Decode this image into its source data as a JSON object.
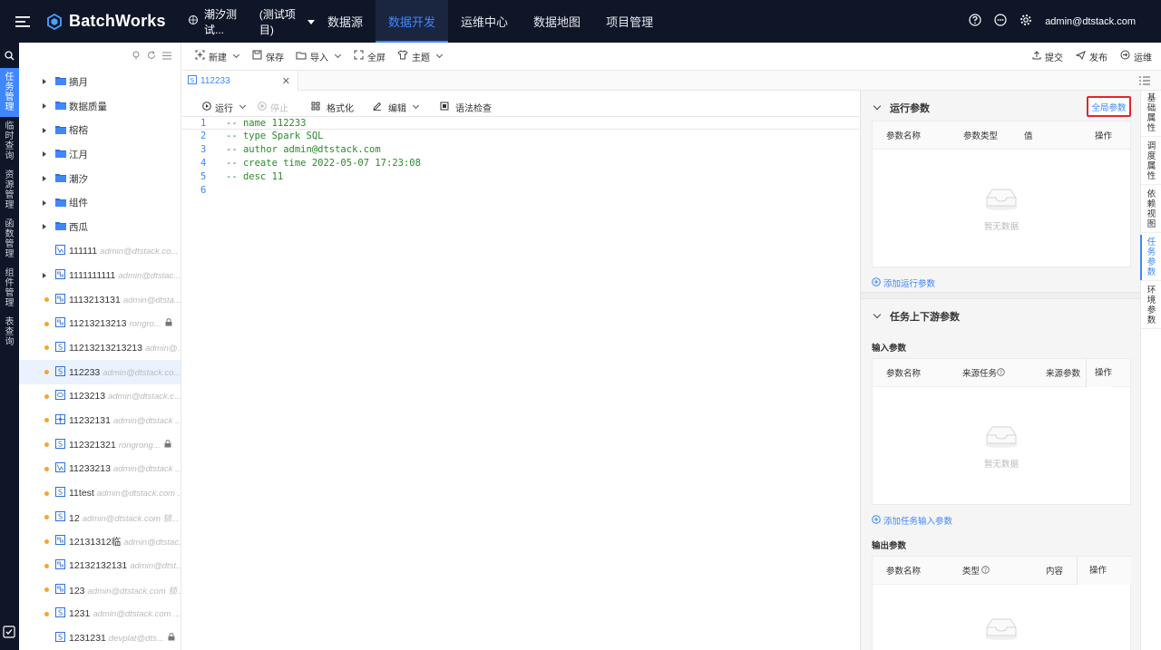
{
  "topbar": {
    "app_name": "BatchWorks",
    "project_name": "潮汐测试...",
    "project_tag": "(测试项目)",
    "nav": [
      "数据源",
      "数据开发",
      "运维中心",
      "数据地图",
      "项目管理"
    ],
    "user": "admin@dtstack.com"
  },
  "leftnav": {
    "items": [
      {
        "chars": [
          "任",
          "务",
          "管",
          "理"
        ],
        "active": true
      },
      {
        "chars": [
          "临",
          "时",
          "查",
          "询"
        ],
        "active": false
      },
      {
        "chars": [
          "资",
          "源",
          "管",
          "理"
        ],
        "active": false
      },
      {
        "chars": [
          "函",
          "数",
          "管",
          "理"
        ],
        "active": false
      },
      {
        "chars": [
          "组",
          "件",
          "管",
          "理"
        ],
        "active": false
      },
      {
        "chars": [
          "表",
          "查",
          "询"
        ],
        "active": false
      }
    ]
  },
  "tree": {
    "folders": [
      "摘月",
      "数据质量",
      "榕榕",
      "江月",
      "潮汐",
      "组件",
      "西瓜"
    ],
    "tasks": [
      {
        "name": "111111",
        "owner": "admin@dtstack.co...",
        "icon": "chart",
        "dot": false,
        "caret": false,
        "lock": false
      },
      {
        "name": "1111111111",
        "owner": "admin@dtstac...",
        "icon": "flow",
        "dot": false,
        "caret": true,
        "lock": false
      },
      {
        "name": "1113213131",
        "owner": "admin@dtsta...",
        "icon": "flow",
        "dot": true,
        "caret": false,
        "lock": false
      },
      {
        "name": "11213213213",
        "owner": "rongro...",
        "icon": "flow",
        "dot": true,
        "caret": false,
        "lock": true
      },
      {
        "name": "11213213213213",
        "owner": "admin@...",
        "icon": "sql",
        "dot": true,
        "caret": false,
        "lock": false
      },
      {
        "name": "112233",
        "owner": "admin@dtstack.co...",
        "icon": "sql",
        "dot": true,
        "caret": false,
        "lock": false,
        "selected": true
      },
      {
        "name": "1123213",
        "owner": "admin@dtstack.c...",
        "icon": "db",
        "dot": true,
        "caret": false,
        "lock": false
      },
      {
        "name": "11232131",
        "owner": "admin@dtstack ...",
        "icon": "grid",
        "dot": true,
        "caret": false,
        "lock": false
      },
      {
        "name": "112321321",
        "owner": "rongrong...",
        "icon": "sql",
        "dot": true,
        "caret": false,
        "lock": true
      },
      {
        "name": "11233213",
        "owner": "admin@dtstack ...",
        "icon": "chart",
        "dot": true,
        "caret": false,
        "lock": false
      },
      {
        "name": "11test",
        "owner": "admin@dtstack.com ...",
        "icon": "sql",
        "dot": true,
        "caret": false,
        "lock": false
      },
      {
        "name": "12",
        "owner": "admin@dtstack.com 锁...",
        "icon": "sql",
        "dot": true,
        "caret": false,
        "lock": false
      },
      {
        "name": "12131312临",
        "owner": "admin@dtstac...",
        "icon": "flow",
        "dot": true,
        "caret": false,
        "lock": false
      },
      {
        "name": "12132132131",
        "owner": "admin@dtst...",
        "icon": "flow",
        "dot": true,
        "caret": false,
        "lock": false
      },
      {
        "name": "123",
        "owner": "admin@dtstack.com 锁...",
        "icon": "flow",
        "dot": true,
        "caret": false,
        "lock": false
      },
      {
        "name": "1231",
        "owner": "admin@dtstack.com ...",
        "icon": "sql",
        "dot": true,
        "caret": false,
        "lock": false
      },
      {
        "name": "1231231",
        "owner": "devplat@dts...",
        "icon": "sql",
        "dot": false,
        "caret": false,
        "lock": true
      }
    ]
  },
  "toolbar": {
    "new": "新建",
    "save": "保存",
    "import": "导入",
    "fullscreen": "全屏",
    "theme": "主题",
    "submit": "提交",
    "publish": "发布",
    "ops": "运维"
  },
  "tab": {
    "label": "112233"
  },
  "editor": {
    "run": "运行",
    "stop": "停止",
    "format": "格式化",
    "edit": "编辑",
    "syntax": "语法检查",
    "lines": [
      "-- name 112233",
      "-- type Spark SQL",
      "-- author admin@dtstack.com",
      "-- create time 2022-05-07 17:23:08",
      "-- desc 11",
      ""
    ]
  },
  "rpanel": {
    "run_params_title": "运行参数",
    "global_params": "全局参数",
    "run_cols": [
      "参数名称",
      "参数类型",
      "值",
      "操作"
    ],
    "empty_text": "暂无数据",
    "add_run_param": "添加运行参数",
    "updown_title": "任务上下游参数",
    "input_label": "输入参数",
    "input_cols": [
      "参数名称",
      "来源任务",
      "来源参数",
      "操作"
    ],
    "add_input_param": "添加任务输入参数",
    "output_label": "输出参数",
    "output_cols": [
      "参数名称",
      "类型",
      "内容",
      "操作"
    ]
  },
  "rtabs": [
    {
      "chars": [
        "基",
        "础",
        "属",
        "性"
      ],
      "active": false
    },
    {
      "chars": [
        "调",
        "度",
        "属",
        "性"
      ],
      "active": false
    },
    {
      "chars": [
        "依",
        "赖",
        "视",
        "图"
      ],
      "active": false
    },
    {
      "chars": [
        "任",
        "务",
        "参",
        "数"
      ],
      "active": true
    },
    {
      "chars": [
        "环",
        "境",
        "参",
        "数"
      ],
      "active": false
    }
  ],
  "colors": {
    "accent": "#3f87ff",
    "topbar": "#0f1628",
    "highlight": "#e0262b",
    "dot": "#f5a623"
  }
}
